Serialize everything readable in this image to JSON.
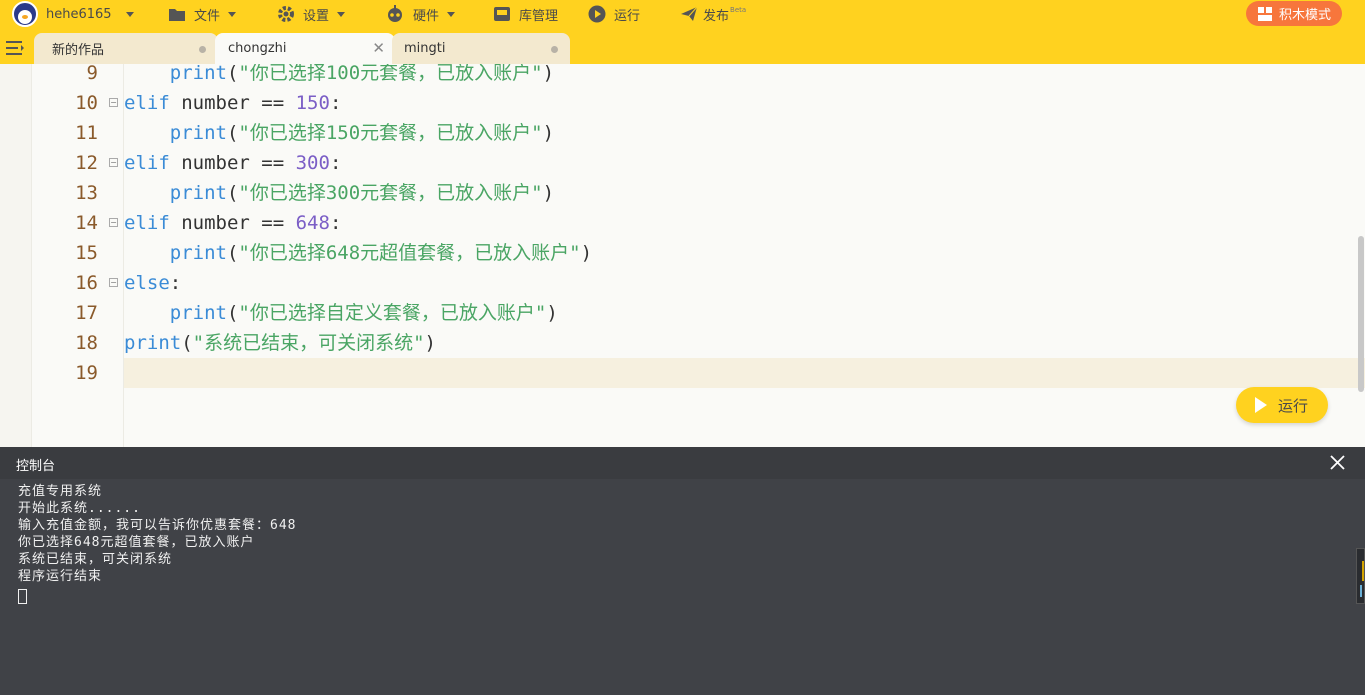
{
  "toolbar": {
    "username": "hehe6165",
    "file": "文件",
    "settings": "设置",
    "hardware": "硬件",
    "library": "库管理",
    "run": "运行",
    "publish": "发布",
    "publish_badge": "Beta",
    "block_mode": "积木模式"
  },
  "tabs": [
    {
      "label": "新的作品",
      "active": false
    },
    {
      "label": "chongzhi",
      "active": true
    },
    {
      "label": "mingti",
      "active": false
    }
  ],
  "editor": {
    "lines": [
      {
        "n": "9",
        "tokens": [
          {
            "t": "    "
          },
          {
            "c": "fn",
            "t": "print"
          },
          {
            "t": "("
          },
          {
            "c": "str",
            "t": "\"你已选择100元套餐，已放入账户\""
          },
          {
            "t": ")"
          }
        ]
      },
      {
        "n": "10",
        "fold": true,
        "tokens": [
          {
            "c": "kw",
            "t": "elif"
          },
          {
            "t": " number == "
          },
          {
            "c": "num",
            "t": "150"
          },
          {
            "t": ":"
          }
        ]
      },
      {
        "n": "11",
        "tokens": [
          {
            "t": "    "
          },
          {
            "c": "fn",
            "t": "print"
          },
          {
            "t": "("
          },
          {
            "c": "str",
            "t": "\"你已选择150元套餐，已放入账户\""
          },
          {
            "t": ")"
          }
        ]
      },
      {
        "n": "12",
        "fold": true,
        "tokens": [
          {
            "c": "kw",
            "t": "elif"
          },
          {
            "t": " number == "
          },
          {
            "c": "num",
            "t": "300"
          },
          {
            "t": ":"
          }
        ]
      },
      {
        "n": "13",
        "tokens": [
          {
            "t": "    "
          },
          {
            "c": "fn",
            "t": "print"
          },
          {
            "t": "("
          },
          {
            "c": "str",
            "t": "\"你已选择300元套餐，已放入账户\""
          },
          {
            "t": ")"
          }
        ]
      },
      {
        "n": "14",
        "fold": true,
        "tokens": [
          {
            "c": "kw",
            "t": "elif"
          },
          {
            "t": " number == "
          },
          {
            "c": "num",
            "t": "648"
          },
          {
            "t": ":"
          }
        ]
      },
      {
        "n": "15",
        "tokens": [
          {
            "t": "    "
          },
          {
            "c": "fn",
            "t": "print"
          },
          {
            "t": "("
          },
          {
            "c": "str",
            "t": "\"你已选择648元超值套餐，已放入账户\""
          },
          {
            "t": ")"
          }
        ]
      },
      {
        "n": "16",
        "fold": true,
        "tokens": [
          {
            "c": "kw",
            "t": "else"
          },
          {
            "t": ":"
          }
        ]
      },
      {
        "n": "17",
        "tokens": [
          {
            "t": "    "
          },
          {
            "c": "fn",
            "t": "print"
          },
          {
            "t": "("
          },
          {
            "c": "str",
            "t": "\"你已选择自定义套餐，已放入账户\""
          },
          {
            "t": ")"
          }
        ]
      },
      {
        "n": "18",
        "tokens": [
          {
            "c": "fn",
            "t": "print"
          },
          {
            "t": "("
          },
          {
            "c": "str",
            "t": "\"系统已结束，可关闭系统\""
          },
          {
            "t": ")"
          }
        ]
      },
      {
        "n": "19",
        "tokens": []
      }
    ],
    "run_button": "运行"
  },
  "console": {
    "title": "控制台",
    "lines": [
      "充值专用系统",
      "开始此系统......",
      "输入充值金额，我可以告诉你优惠套餐：648",
      "你已选择648元超值套餐，已放入账户",
      "系统已结束，可关闭系统",
      "程序运行结束"
    ]
  },
  "colors": {
    "toolbar": "#ffd21f",
    "block_mode": "#f7763c",
    "keyword": "#3a8bd6",
    "number": "#7b5ec6",
    "string": "#4aa564",
    "line_number": "#8a5a2b",
    "console_bg": "#404247"
  }
}
